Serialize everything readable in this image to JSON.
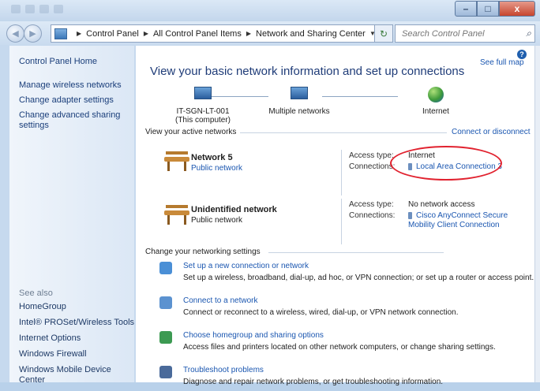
{
  "window": {
    "close_label": "x"
  },
  "breadcrumb": [
    "Control Panel",
    "All Control Panel Items",
    "Network and Sharing Center"
  ],
  "search": {
    "placeholder": "Search Control Panel"
  },
  "left": {
    "home": "Control Panel Home",
    "tasks": [
      "Manage wireless networks",
      "Change adapter settings",
      "Change advanced sharing settings"
    ],
    "see_also_title": "See also",
    "see_also": [
      "HomeGroup",
      "Intel® PROSet/Wireless Tools",
      "Internet Options",
      "Windows Firewall",
      "Windows Mobile Device Center"
    ]
  },
  "main": {
    "title": "View your basic network information and set up connections",
    "see_full_map": "See full map",
    "map": {
      "computer": "IT-SGN-LT-001",
      "computer_sub": "(This computer)",
      "middle": "Multiple networks",
      "right": "Internet"
    },
    "active_title": "View your active networks",
    "connect_disconnect": "Connect or disconnect",
    "networks": [
      {
        "name": "Network 5",
        "type": "Public network",
        "access_label": "Access type:",
        "access": "Internet",
        "conn_label": "Connections:",
        "conn": "Local Area Connection 3"
      },
      {
        "name": "Unidentified network",
        "type": "Public network",
        "access_label": "Access type:",
        "access": "No network access",
        "conn_label": "Connections:",
        "conn": "Cisco AnyConnect Secure Mobility Client Connection"
      }
    ],
    "change_title": "Change your networking settings",
    "tasks": [
      {
        "link": "Set up a new connection or network",
        "desc": "Set up a wireless, broadband, dial-up, ad hoc, or VPN connection; or set up a router or access point.",
        "icon_color": "#4a8fd6"
      },
      {
        "link": "Connect to a network",
        "desc": "Connect or reconnect to a wireless, wired, dial-up, or VPN network connection.",
        "icon_color": "#5b92d0"
      },
      {
        "link": "Choose homegroup and sharing options",
        "desc": "Access files and printers located on other network computers, or change sharing settings.",
        "icon_color": "#3c9a52"
      },
      {
        "link": "Troubleshoot problems",
        "desc": "Diagnose and repair network problems, or get troubleshooting information.",
        "icon_color": "#4a6a9a"
      }
    ]
  }
}
